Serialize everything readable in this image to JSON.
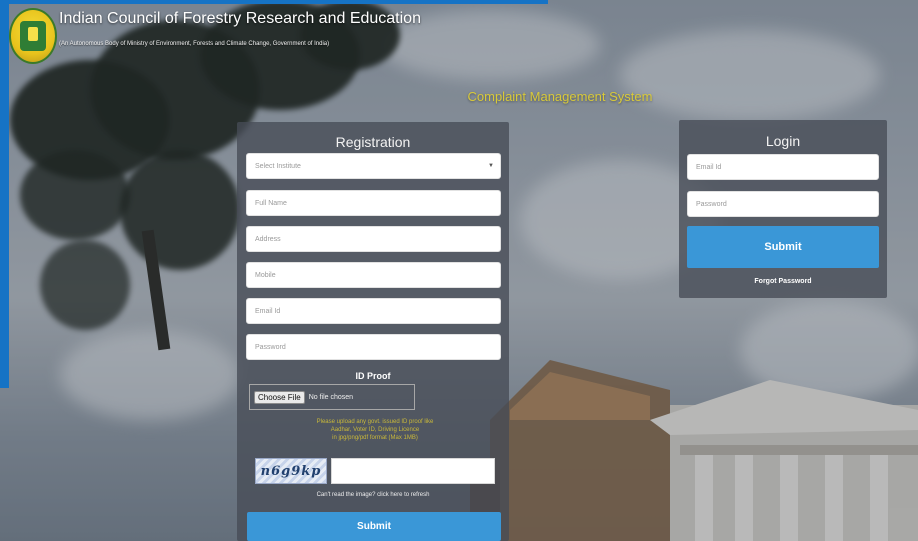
{
  "header": {
    "org_title": "Indian Council of Forestry Research and Education",
    "org_subtitle": "(An Autonomous Body of Ministry of Environment, Forests and Climate Change, Government of India)"
  },
  "system_title": "Complaint Management System",
  "registration": {
    "title": "Registration",
    "select_institute": "Select Institute",
    "full_name_placeholder": "Full Name",
    "address_placeholder": "Address",
    "mobile_placeholder": "Mobile",
    "email_placeholder": "Email Id",
    "password_placeholder": "Password",
    "id_proof_label": "ID Proof",
    "choose_file": "Choose File",
    "no_file": "No file chosen",
    "note_line1": "Please upload any govt. issued ID proof like",
    "note_line2": "Aadhar, Voter ID, Driving Licence",
    "note_line3": "in jpg/png/pdf format (Max 1MB)",
    "captcha_text": "n6g9kp",
    "captcha_help": "Can't read the image? click here to refresh",
    "submit": "Submit"
  },
  "login": {
    "title": "Login",
    "email_placeholder": "Email Id",
    "password_placeholder": "Password",
    "submit": "Submit",
    "forgot": "Forgot Password"
  },
  "colors": {
    "accent_blue": "#3a97d7",
    "brand_band": "#1673c5",
    "title_yellow": "#d8c93a"
  },
  "icons": {
    "logo": "icfre-logo",
    "dropdown": "caret-down-icon"
  }
}
